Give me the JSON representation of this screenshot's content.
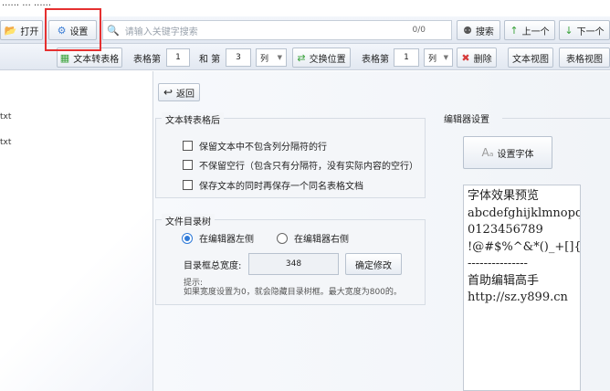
{
  "window": {
    "title": "...... ...  ......"
  },
  "toolbar": {
    "open_label": "打开",
    "settings_label": "设置",
    "search_placeholder": "请输入关键字搜索",
    "search_count": "0/0",
    "search_button": "搜索",
    "prev_button": "上一个",
    "next_button": "下一个"
  },
  "toolbar2": {
    "text_to_table_button": "文本转表格",
    "table_label": "表格第",
    "table_value_1": "1",
    "and_label": "和 第",
    "table_value_2": "3",
    "column_select": "列",
    "swap_button": "交换位置",
    "table_label_2": "表格第",
    "table_value_3": "1",
    "column_select_2": "列",
    "delete_button": "删除",
    "text_view_button": "文本视图",
    "table_view_button": "表格视图"
  },
  "left_pane": {
    "files": [
      "txt",
      "txt"
    ]
  },
  "settings": {
    "back_label": "返回",
    "text_to_table_group": {
      "title": "文本转表格后",
      "options": [
        "保留文本中不包含列分隔符的行",
        "不保留空行（包含只有分隔符，没有实际内容的空行）",
        "保存文本的同时再保存一个同名表格文档"
      ]
    },
    "tree_group": {
      "title": "文件目录树",
      "radio_left": "在编辑器左侧",
      "radio_right": "在编辑器右侧",
      "width_label": "目录框总宽度:",
      "width_value": "348",
      "confirm_button": "确定修改",
      "hint_title": "提示:",
      "hint_text": "如果宽度设置为0，就会隐藏目录树框。最大宽度为800的。"
    },
    "editor_group": {
      "title": "编辑器设置",
      "font_button": "设置字体",
      "preview_lines": [
        "字体效果预览",
        "abcdefghijklmnopqr",
        "0123456789",
        "!@#$%^&*()_+[]{}-=",
        "---------------",
        "首助编辑高手",
        "http://sz.y899.cn"
      ]
    }
  },
  "colors": {
    "highlight": "#e53030",
    "accent": "#2f7ad8"
  }
}
